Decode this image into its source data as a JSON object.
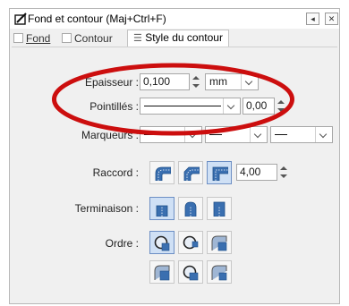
{
  "window": {
    "title": "Fond et contour (Maj+Ctrl+F)",
    "buttons": [
      "◂",
      "✕"
    ]
  },
  "tabs": [
    {
      "label": "Fond",
      "active": false
    },
    {
      "label": "Contour",
      "active": false
    },
    {
      "label": "Style du contour",
      "active": true
    }
  ],
  "stroke_style": {
    "width_label": "Épaisseur :",
    "width_value": "0,100",
    "unit": "mm",
    "dashes_label": "Pointillés :",
    "dash_offset": "0,00",
    "markers_label": "Marqueurs :",
    "join_label": "Raccord :",
    "miter_limit": "4,00",
    "cap_label": "Terminaison :",
    "order_label": "Ordre :"
  },
  "colors": {
    "annotation": "#cc0e0e",
    "accent": "#1f5ea8",
    "selected_bg": "#cfe0f5"
  },
  "icons": {
    "title": "stroke-style-icon",
    "tab_style": "stroke-lines-icon"
  }
}
